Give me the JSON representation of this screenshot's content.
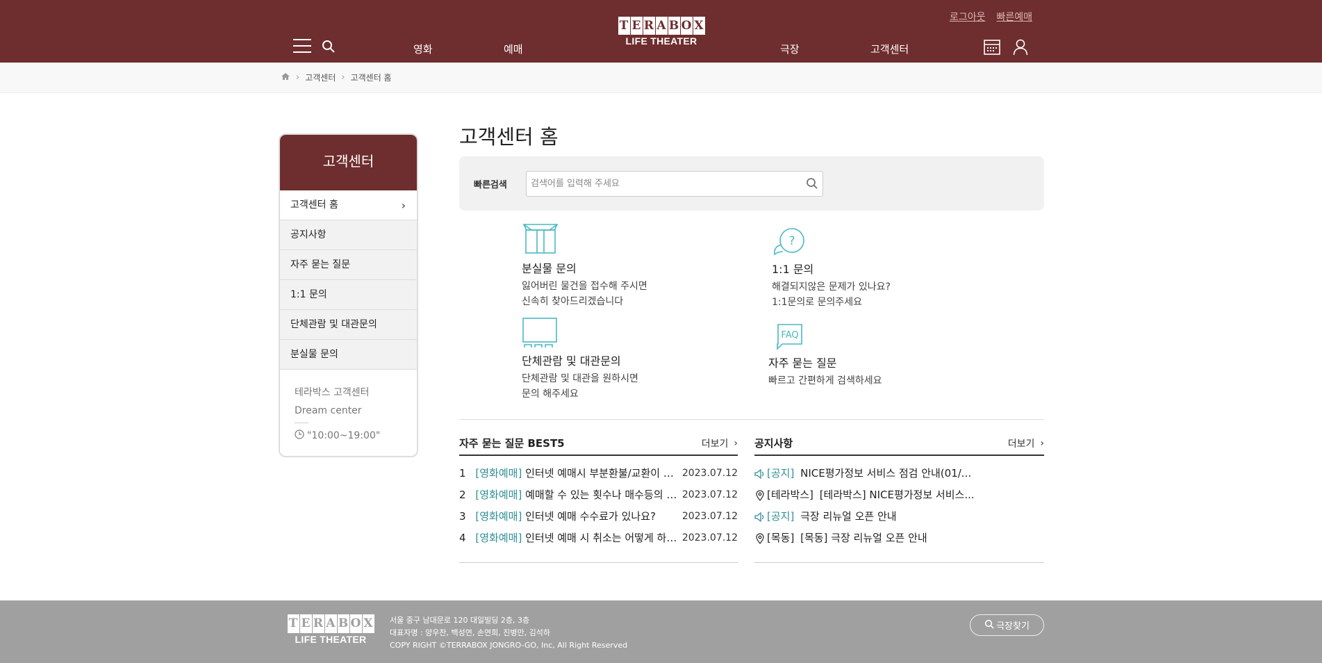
{
  "header": {
    "util": {
      "logout": "로그아웃",
      "quick_booking": "빠른예매"
    },
    "logo_letters": [
      "T",
      "E",
      "R",
      "A",
      "B",
      "O",
      "X"
    ],
    "logo_sub": "LIFE THEATER",
    "nav": {
      "movie": "영화",
      "booking": "예매",
      "theater": "극장",
      "support": "고객센터"
    }
  },
  "breadcrumb": {
    "level1": "고객센터",
    "level2": "고객센터 홈"
  },
  "sidebar": {
    "title": "고객센터",
    "items": [
      {
        "label": "고객센터 홈"
      },
      {
        "label": "공지사항"
      },
      {
        "label": "자주 묻는 질문"
      },
      {
        "label": "1:1 문의"
      },
      {
        "label": "단체관람 및 대관문의"
      },
      {
        "label": "분실물 문의"
      }
    ],
    "center_name": "테라박스 고객센터",
    "center_sub": "Dream center",
    "hours": "\"10:00~19:00\""
  },
  "main": {
    "page_title": "고객센터 홈",
    "quick_search": {
      "label": "빠른검색",
      "placeholder": "검색어를 입력해 주세요"
    },
    "cards": {
      "lost": {
        "title": "분실물 문의",
        "desc1": "잃어버린 물건을 접수해 주시면",
        "desc2": "신속히 찾아드리겠습니다"
      },
      "inquiry": {
        "title": "1:1 문의",
        "desc1": "해결되지않은 문제가 있나요?",
        "desc2": "1:1문의로 문의주세요"
      },
      "group": {
        "title": "단체관람 및 대관문의",
        "desc1": "단체관람 및 대관을 원하시면",
        "desc2": "문의 해주세요"
      },
      "faq": {
        "title": "자주 묻는 질문",
        "desc1": "빠르고 간편하게 검색하세요",
        "icon_text": "FAQ"
      }
    },
    "faq_panel": {
      "title": "자주 묻는 질문 BEST5",
      "more": "더보기",
      "items": [
        {
          "num": "1",
          "cat": "[영화예매]",
          "q": "인터넷 예매시 부분환불/교환이 가능한가요?",
          "date": "2023.07.12"
        },
        {
          "num": "2",
          "cat": "[영화예매]",
          "q": "예매할 수 있는 횟수나 매수등의 제한이 있나요?",
          "date": "2023.07.12"
        },
        {
          "num": "3",
          "cat": "[영화예매]",
          "q": "인터넷 예매 수수료가 있나요?",
          "date": "2023.07.12"
        },
        {
          "num": "4",
          "cat": "[영화예매]",
          "q": "인터넷 예매 시 취소는 어떻게 하나요?",
          "date": "2023.07.12"
        }
      ]
    },
    "notice_panel": {
      "title": "공지사항",
      "more": "더보기",
      "items": [
        {
          "icon": "speaker-icon",
          "cat": "[공지]",
          "q": "NICE평가정보 서비스 점검 안내(01/..."
        },
        {
          "icon": "pin-icon",
          "cat": "[테라박스]",
          "q": "[테라박스] NICE평가정보 서비스..."
        },
        {
          "icon": "speaker-icon",
          "cat": "[공지]",
          "q": "극장 리뉴얼 오픈 안내"
        },
        {
          "icon": "pin-icon",
          "cat": "[목동]",
          "q": "[목동] 극장 리뉴얼 오픈 안내"
        }
      ]
    }
  },
  "footer": {
    "address": "서울 중구 남대문로 120 대일빌딩 2층, 3층",
    "reps": "대표자명 : 양우찬, 백성연, 손연희, 진병만, 김석하",
    "copyright": "COPY RIGHT ©TERRABOX JONGRO-GO, Inc, All Right Reserved",
    "find_theater": "극장찾기"
  },
  "colors": {
    "brand": "#6e2d2e",
    "accent": "#2e8e96",
    "icon_teal": "#49b8c2",
    "footer": "#a0a0a0"
  }
}
